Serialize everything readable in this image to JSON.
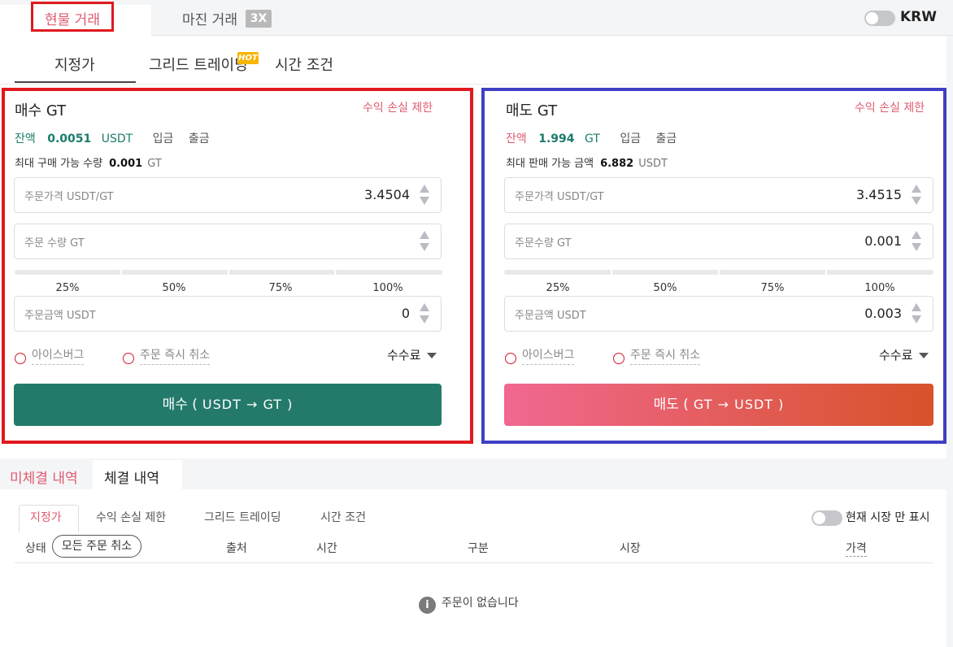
{
  "top_tabs": {
    "spot": "현물 거래",
    "margin": "마진 거래",
    "margin_badge": "3X",
    "currency_toggle": "KRW"
  },
  "order_types": {
    "limit": "지정가",
    "grid": "그리드 트레이딩",
    "grid_badge": "HOT",
    "time": "시간 조건"
  },
  "buy": {
    "title": "매수 GT",
    "tp_sl": "수익 손실 제한",
    "balance_label": "잔액",
    "balance_value": "0.0051",
    "balance_unit": "USDT",
    "deposit": "입금",
    "withdraw": "출금",
    "max_label": "최대 구매 가능 수량",
    "max_value": "0.001",
    "max_unit": "GT",
    "price_label": "주문가격 USDT/GT",
    "price_value": "3.4504",
    "qty_label": "주문 수량 GT",
    "qty_value": "",
    "amount_label": "주문금액 USDT",
    "amount_value": "0",
    "iceberg": "아이스버그",
    "ioc": "주문 즉시 취소",
    "fee": "수수료",
    "button_label": "매수 (",
    "button_pair": "USDT → GT )"
  },
  "sell": {
    "title": "매도 GT",
    "tp_sl": "수익 손실 제한",
    "balance_label": "잔액",
    "balance_value": "1.994",
    "balance_unit": "GT",
    "deposit": "입금",
    "withdraw": "출금",
    "max_label": "최대 판매 가능 금액",
    "max_value": "6.882",
    "max_unit": "USDT",
    "price_label": "주문가격 USDT/GT",
    "price_value": "3.4515",
    "qty_label": "주문수량 GT",
    "qty_value": "0.001",
    "amount_label": "주문금액 USDT",
    "amount_value": "0.003",
    "iceberg": "아이스버그",
    "ioc": "주문 즉시 취소",
    "fee": "수수료",
    "button_label": "매도 (",
    "button_pair": "GT → USDT )"
  },
  "percents": [
    "25%",
    "50%",
    "75%",
    "100%"
  ],
  "orders": {
    "tab_open": "미체결 내역",
    "tab_history": "체결 내역",
    "subtabs": [
      "지정가",
      "수익 손실 제한",
      "그리드 트레이딩",
      "시간 조건"
    ],
    "current_market_only": "현재 시장 만 표시",
    "columns": {
      "status": "상태",
      "cancel_all": "모든 주문 취소",
      "source": "출처",
      "time": "시간",
      "side": "구분",
      "market": "시장",
      "price": "가격"
    },
    "empty": "주문이 없습니다"
  },
  "colors": {
    "buy": "#237a6a",
    "sell_start": "#f06890",
    "sell_end": "#d8522a",
    "highlight_red": "#e0191f",
    "highlight_blue": "#3f3fc4"
  }
}
